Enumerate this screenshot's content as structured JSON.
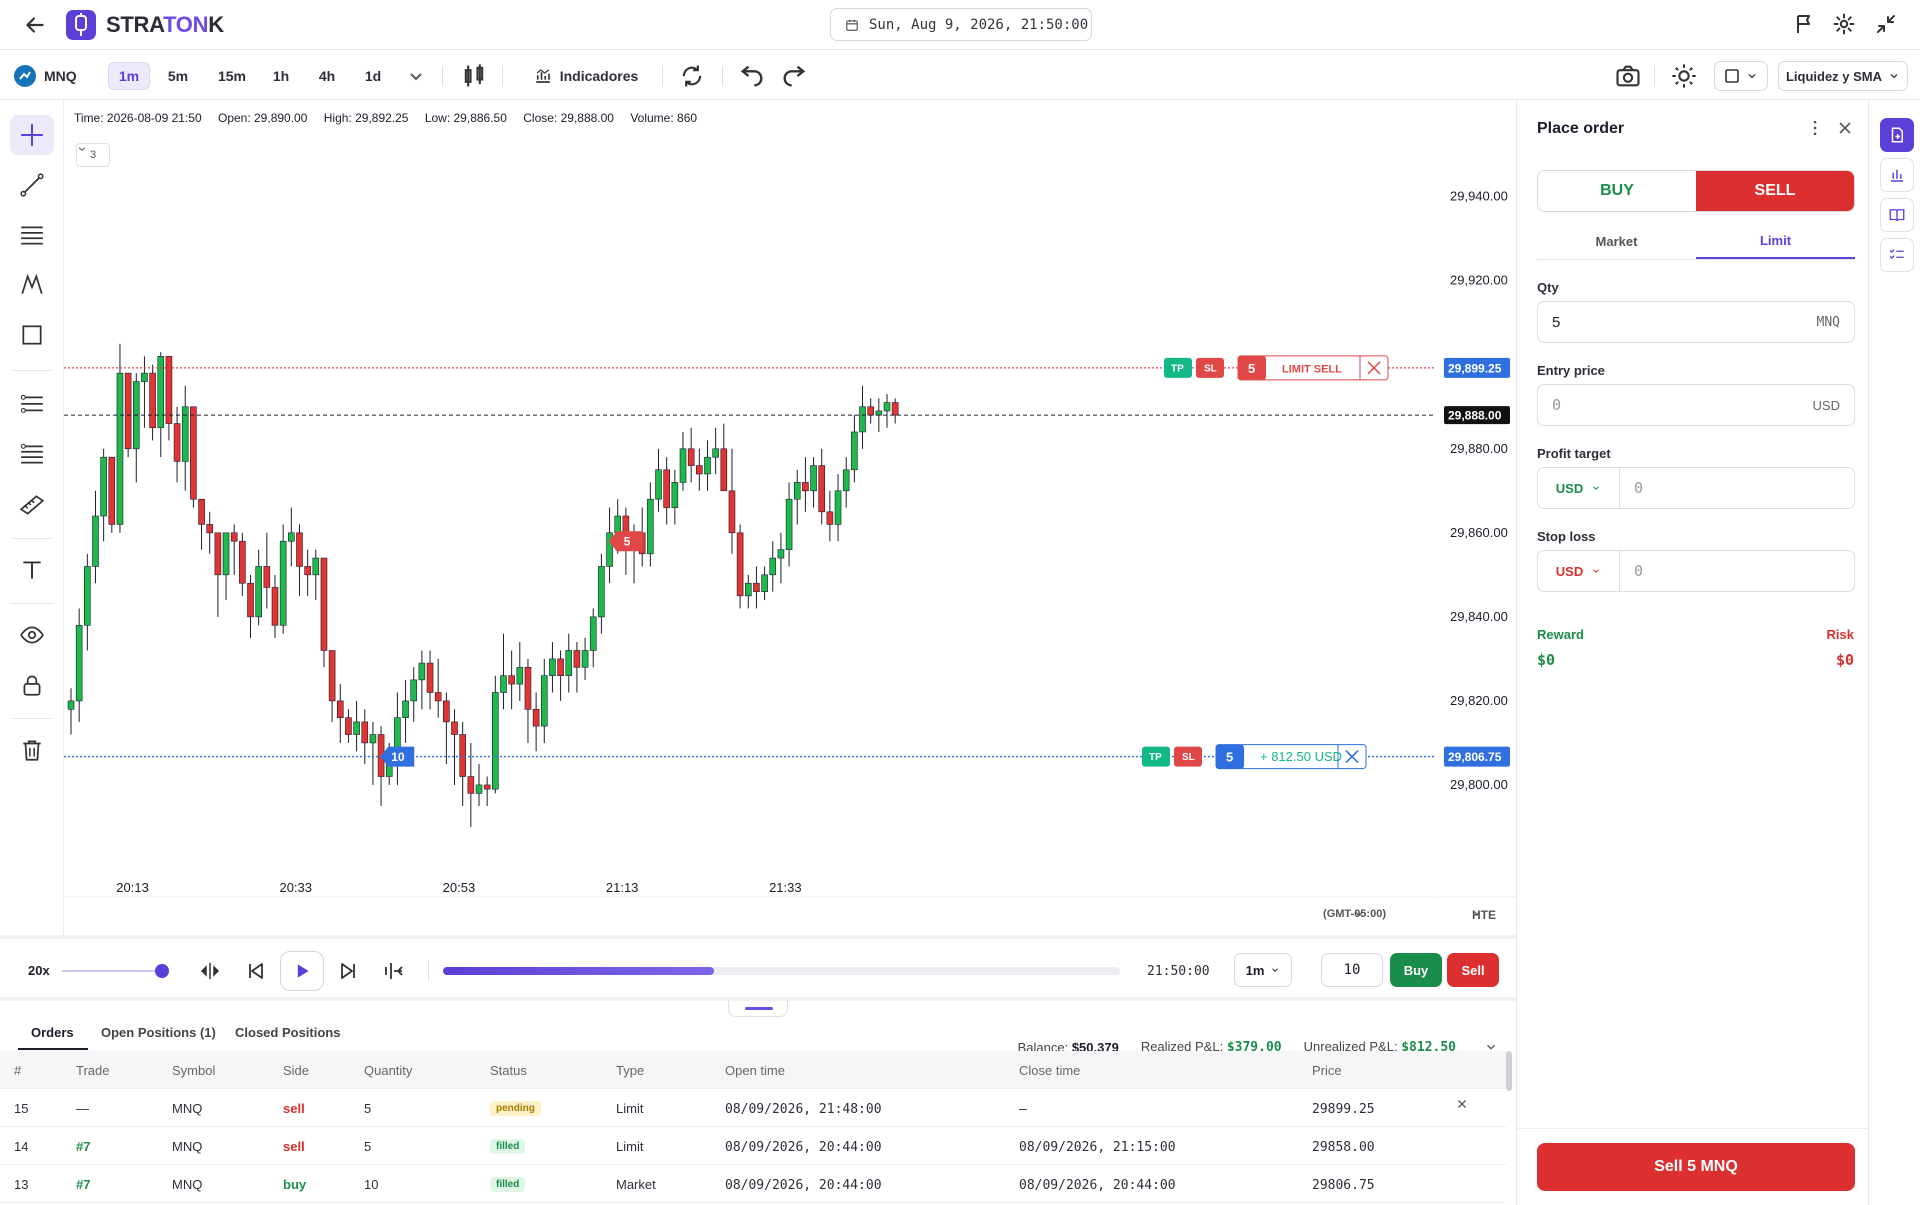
{
  "header": {
    "brand_a": "STRA",
    "brand_b": "TON",
    "brand_c": "K",
    "datetime": "Sun, Aug 9, 2026, 21:50:00"
  },
  "toolbar": {
    "symbol": "MNQ",
    "timeframes": [
      "1m",
      "5m",
      "15m",
      "1h",
      "4h",
      "1d"
    ],
    "active_timeframe": "1m",
    "indicators_label": "Indicadores",
    "layout_label": "Liquidez y SMA"
  },
  "ohlc": {
    "time": "Time: 2026-08-09 21:50",
    "open": "Open: 29,890.00",
    "high": "High: 29,892.25",
    "low": "Low: 29,886.50",
    "close": "Close: 29,888.00",
    "volume": "Volume: 860"
  },
  "indicator_badge": "3",
  "chart_data": {
    "type": "candlestick",
    "symbol": "MNQ",
    "timeframe": "1m",
    "y_ticks": [
      29940,
      29920,
      29880,
      29860,
      29840,
      29820,
      29800
    ],
    "y_tick_labels": [
      "29,940.00",
      "29,920.00",
      "29,880.00",
      "29,860.00",
      "29,840.00",
      "29,820.00",
      "29,800.00"
    ],
    "ylim": [
      29775,
      29963
    ],
    "x_tick_labels": [
      "20:13",
      "20:33",
      "20:53",
      "21:13",
      "21:33"
    ],
    "x_tick_index": [
      8,
      28,
      48,
      68,
      88
    ],
    "candles": [
      [
        29818,
        29823,
        29812,
        29820
      ],
      [
        29820,
        29842,
        29815,
        29838
      ],
      [
        29838,
        29855,
        29832,
        29852
      ],
      [
        29852,
        29870,
        29848,
        29864
      ],
      [
        29864,
        29880,
        29858,
        29878
      ],
      [
        29878,
        29872,
        29860,
        29862
      ],
      [
        29862,
        29905,
        29860,
        29898
      ],
      [
        29898,
        29893,
        29878,
        29880
      ],
      [
        29880,
        29898,
        29872,
        29896
      ],
      [
        29896,
        29902,
        29885,
        29898
      ],
      [
        29898,
        29900,
        29882,
        29885
      ],
      [
        29885,
        29903,
        29878,
        29902
      ],
      [
        29902,
        29895,
        29882,
        29886
      ],
      [
        29886,
        29890,
        29872,
        29877
      ],
      [
        29877,
        29895,
        29870,
        29890
      ],
      [
        29890,
        29882,
        29866,
        29868
      ],
      [
        29868,
        29864,
        29856,
        29862
      ],
      [
        29862,
        29865,
        29855,
        29860
      ],
      [
        29860,
        29854,
        29840,
        29850
      ],
      [
        29850,
        29854,
        29844,
        29860
      ],
      [
        29860,
        29862,
        29850,
        29858
      ],
      [
        29858,
        29860,
        29845,
        29848
      ],
      [
        29848,
        29850,
        29835,
        29840
      ],
      [
        29840,
        29856,
        29838,
        29852
      ],
      [
        29852,
        29860,
        29842,
        29847
      ],
      [
        29847,
        29850,
        29835,
        29838
      ],
      [
        29838,
        29862,
        29836,
        29858
      ],
      [
        29858,
        29866,
        29852,
        29860
      ],
      [
        29860,
        29862,
        29845,
        29852
      ],
      [
        29852,
        29856,
        29845,
        29850
      ],
      [
        29850,
        29856,
        29844,
        29854
      ],
      [
        29854,
        29852,
        29828,
        29832
      ],
      [
        29832,
        29830,
        29815,
        29820
      ],
      [
        29820,
        29824,
        29810,
        29816
      ],
      [
        29816,
        29818,
        29810,
        29812
      ],
      [
        29812,
        29820,
        29808,
        29815
      ],
      [
        29815,
        29818,
        29805,
        29810
      ],
      [
        29810,
        29815,
        29800,
        29812
      ],
      [
        29812,
        29814,
        29795,
        29802
      ],
      [
        29802,
        29810,
        29800,
        29806
      ],
      [
        29806,
        29822,
        29800,
        29816
      ],
      [
        29816,
        29825,
        29810,
        29820
      ],
      [
        29820,
        29828,
        29815,
        29825
      ],
      [
        29825,
        29832,
        29818,
        29829
      ],
      [
        29829,
        29832,
        29818,
        29822
      ],
      [
        29822,
        29830,
        29816,
        29820
      ],
      [
        29820,
        29822,
        29805,
        29815
      ],
      [
        29815,
        29818,
        29800,
        29812
      ],
      [
        29812,
        29815,
        29795,
        29802
      ],
      [
        29802,
        29810,
        29790,
        29798
      ],
      [
        29798,
        29805,
        29795,
        29800
      ],
      [
        29800,
        29802,
        29795,
        29799
      ],
      [
        29799,
        29826,
        29798,
        29822
      ],
      [
        29822,
        29836,
        29818,
        29826
      ],
      [
        29826,
        29832,
        29818,
        29824
      ],
      [
        29824,
        29834,
        29820,
        29828
      ],
      [
        29828,
        29830,
        29810,
        29818
      ],
      [
        29818,
        29822,
        29808,
        29814
      ],
      [
        29814,
        29830,
        29810,
        29826
      ],
      [
        29826,
        29834,
        29822,
        29830
      ],
      [
        29830,
        29832,
        29820,
        29826
      ],
      [
        29826,
        29836,
        29822,
        29832
      ],
      [
        29832,
        29834,
        29822,
        29828
      ],
      [
        29828,
        29835,
        29825,
        29832
      ],
      [
        29832,
        29842,
        29828,
        29840
      ],
      [
        29840,
        29855,
        29836,
        29852
      ],
      [
        29852,
        29866,
        29848,
        29860
      ],
      [
        29860,
        29868,
        29855,
        29864
      ],
      [
        29864,
        29866,
        29850,
        29856
      ],
      [
        29856,
        29862,
        29848,
        29860
      ],
      [
        29860,
        29866,
        29852,
        29855
      ],
      [
        29855,
        29872,
        29852,
        29868
      ],
      [
        29868,
        29880,
        29865,
        29875
      ],
      [
        29875,
        29878,
        29862,
        29866
      ],
      [
        29866,
        29875,
        29862,
        29872
      ],
      [
        29872,
        29884,
        29870,
        29880
      ],
      [
        29880,
        29885,
        29872,
        29876
      ],
      [
        29876,
        29880,
        29870,
        29874
      ],
      [
        29874,
        29882,
        29870,
        29878
      ],
      [
        29878,
        29885,
        29874,
        29880
      ],
      [
        29880,
        29886,
        29872,
        29870
      ],
      [
        29870,
        29880,
        29855,
        29860
      ],
      [
        29860,
        29862,
        29842,
        29845
      ],
      [
        29845,
        29850,
        29842,
        29848
      ],
      [
        29848,
        29852,
        29842,
        29846
      ],
      [
        29846,
        29852,
        29844,
        29850
      ],
      [
        29850,
        29858,
        29846,
        29854
      ],
      [
        29854,
        29860,
        29848,
        29856
      ],
      [
        29856,
        29872,
        29852,
        29868
      ],
      [
        29868,
        29875,
        29862,
        29872
      ],
      [
        29872,
        29878,
        29865,
        29870
      ],
      [
        29870,
        29878,
        29866,
        29876
      ],
      [
        29876,
        29880,
        29862,
        29865
      ],
      [
        29865,
        29870,
        29858,
        29862
      ],
      [
        29862,
        29874,
        29858,
        29870
      ],
      [
        29870,
        29878,
        29866,
        29875
      ],
      [
        29875,
        29888,
        29872,
        29884
      ],
      [
        29884,
        29895,
        29880,
        29890
      ],
      [
        29890,
        29892,
        29886,
        29888
      ],
      [
        29888,
        29892,
        29884,
        29889
      ],
      [
        29889,
        29893,
        29885,
        29891
      ],
      [
        29891,
        29892,
        29886,
        29888
      ]
    ],
    "orders": [
      {
        "price": 29899.25,
        "price_label": "29,899.25",
        "side": "sell",
        "qty": "5",
        "label": "LIMIT SELL",
        "tp": "TP",
        "sl": "SL"
      },
      {
        "price": 29806.75,
        "price_label": "29,806.75",
        "side": "buy",
        "qty": "5",
        "label": "+ 812.50 USD",
        "tp": "TP",
        "sl": "SL"
      }
    ],
    "last_price": 29888.0,
    "last_price_label": "29,888.00",
    "markers": [
      {
        "index": 39,
        "price": 29806.75,
        "text": "10",
        "side": "buy"
      },
      {
        "index": 67,
        "price": 29858,
        "text": "5",
        "side": "sell"
      }
    ]
  },
  "chart_footer": {
    "timezone": "(GMT-05:00)",
    "exchange": "HTE"
  },
  "panel": {
    "title": "Place order",
    "buy_label": "BUY",
    "sell_label": "SELL",
    "tabs": [
      "Market",
      "Limit"
    ],
    "qty_label": "Qty",
    "qty_value": "5",
    "qty_unit": "MNQ",
    "entry_label": "Entry price",
    "entry_placeholder": "0",
    "entry_unit": "USD",
    "profit_label": "Profit target",
    "profit_currency": "USD",
    "profit_placeholder": "0",
    "stop_label": "Stop loss",
    "stop_currency": "USD",
    "stop_placeholder": "0",
    "reward_label": "Reward",
    "risk_label": "Risk",
    "reward_value": "$0",
    "risk_value": "$0",
    "submit_label": "Sell 5 MNQ"
  },
  "replay": {
    "speed": "20x",
    "progress": 0.4,
    "time": "21:50:00",
    "timeframe": "1m",
    "qty": "10",
    "buy_label": "Buy",
    "sell_label": "Sell"
  },
  "bottom": {
    "tabs": [
      "Orders",
      "Open Positions (1)",
      "Closed Positions"
    ],
    "balance_label": "Balance:",
    "balance_value": "$50,379",
    "realized_label": "Realized P&L:",
    "realized_value": "$379.00",
    "unrealized_label": "Unrealized P&L:",
    "unrealized_value": "$812.50",
    "columns": [
      "#",
      "Trade",
      "Symbol",
      "Side",
      "Quantity",
      "Status",
      "Type",
      "Open time",
      "Close time",
      "Price"
    ],
    "rows": [
      {
        "id": "15",
        "trade": "—",
        "symbol": "MNQ",
        "side": "sell",
        "qty": "5",
        "status": "pending",
        "type": "Limit",
        "open": "08/09/2026, 21:48:00",
        "close": "—",
        "price": "29899.25"
      },
      {
        "id": "14",
        "trade": "#7",
        "symbol": "MNQ",
        "side": "sell",
        "qty": "5",
        "status": "filled",
        "type": "Limit",
        "open": "08/09/2026, 20:44:00",
        "close": "08/09/2026, 21:15:00",
        "price": "29858.00"
      },
      {
        "id": "13",
        "trade": "#7",
        "symbol": "MNQ",
        "side": "buy",
        "qty": "10",
        "status": "filled",
        "type": "Market",
        "open": "08/09/2026, 20:44:00",
        "close": "08/09/2026, 20:44:00",
        "price": "29806.75"
      }
    ]
  },
  "colors": {
    "accent": "#5b3fd6",
    "up": "#1db94c",
    "down": "#e23434",
    "buy": "#1a8d4a",
    "sell": "#dc2f2f"
  }
}
